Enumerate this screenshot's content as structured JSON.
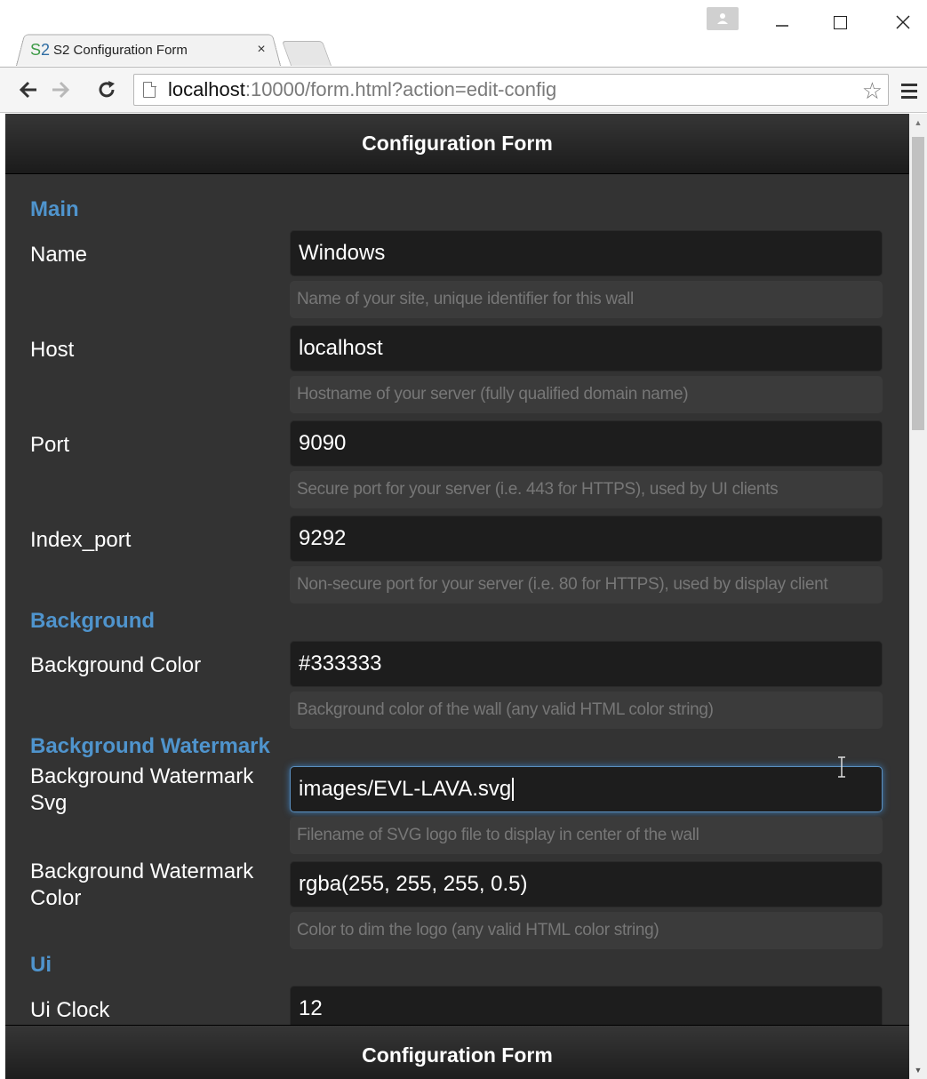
{
  "browser": {
    "tab_favicon": "S2",
    "tab_title": "S2 Configuration Form",
    "tab_close": "×",
    "url_host": "localhost",
    "url_rest": ":10000/form.html?action=edit-config",
    "icons": {
      "back": "back-arrow-icon",
      "forward": "forward-arrow-icon",
      "reload": "reload-icon",
      "bookmark": "star-icon",
      "menu": "hamburger-menu-icon"
    }
  },
  "page": {
    "header_title": "Configuration Form",
    "footer_title": "Configuration Form",
    "colors": {
      "background": "#333333",
      "section_title": "#4f94cd",
      "input_bg": "#1d1d1d",
      "help_text": "#777777"
    }
  },
  "form": {
    "main": {
      "title": "Main",
      "name": {
        "label": "Name",
        "value": "Windows",
        "help": "Name of your site, unique identifier for this wall"
      },
      "host": {
        "label": "Host",
        "value": "localhost",
        "help": "Hostname of your server (fully qualified domain name)"
      },
      "port": {
        "label": "Port",
        "value": "9090",
        "help": "Secure port for your server (i.e. 443 for HTTPS), used by UI clients"
      },
      "index_port": {
        "label": "Index_port",
        "value": "9292",
        "help": "Non-secure port for your server (i.e. 80 for HTTPS), used by display client"
      }
    },
    "background": {
      "title": "Background",
      "color": {
        "label": "Background Color",
        "value": "#333333",
        "help": "Background color of the wall (any valid HTML color string)"
      }
    },
    "watermark": {
      "title": "Background Watermark",
      "svg": {
        "label": "Background Watermark Svg",
        "value": "images/EVL-LAVA.svg",
        "help": "Filename of SVG logo file to display in center of the wall"
      },
      "color": {
        "label": "Background Watermark Color",
        "value": "rgba(255, 255, 255, 0.5)",
        "help": "Color to dim the logo (any valid HTML color string)"
      }
    },
    "ui": {
      "title": "Ui",
      "clock": {
        "label": "Ui Clock",
        "value": "12"
      }
    }
  }
}
